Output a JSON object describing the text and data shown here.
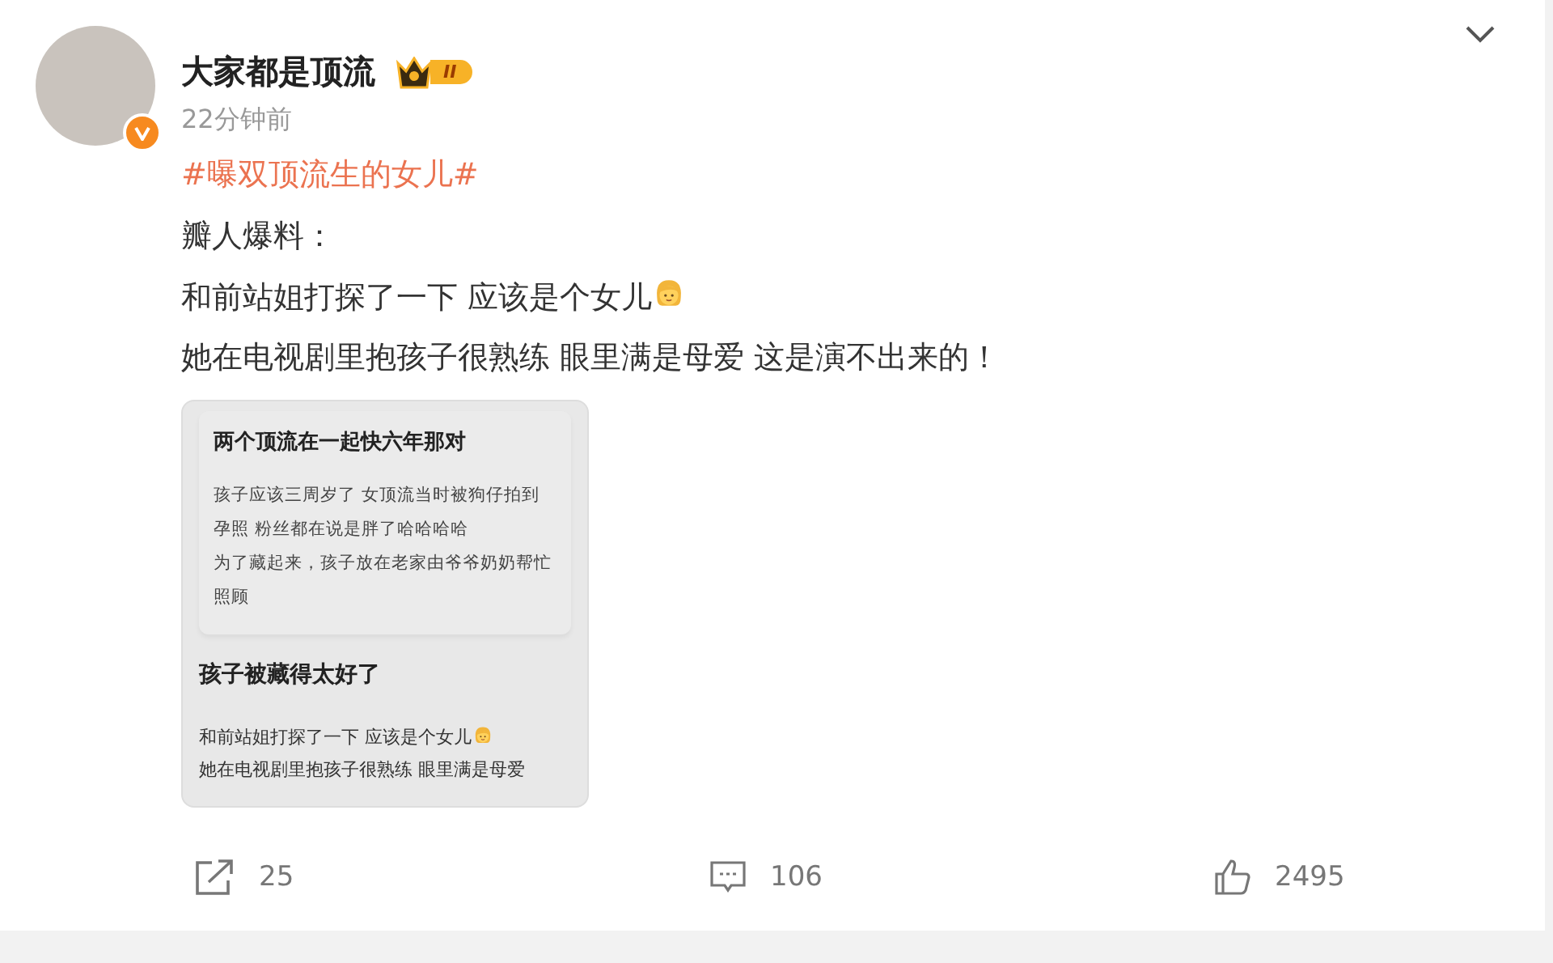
{
  "post": {
    "author": {
      "name": "大家都是顶流",
      "level_badge": "II",
      "verified": true
    },
    "time": "22分钟前",
    "hashtag": "#曝双顶流生的女儿#",
    "lines": [
      {
        "text": "瓣人爆料：",
        "emoji": false
      },
      {
        "text": "和前站姐打探了一下 应该是个女儿",
        "emoji": true
      },
      {
        "text": "她在电视剧里抱孩子很熟练 眼里满是母爱 这是演不出来的！",
        "emoji": false
      }
    ],
    "attached_image": {
      "card_title": "两个顶流在一起快六年那对",
      "card_lines": [
        "孩子应该三周岁了  女顶流当时被狗仔拍到",
        "孕照   粉丝都在说是胖了哈哈哈哈",
        "为了藏起来，孩子放在老家由爷爷奶奶帮忙",
        "照顾"
      ],
      "heading": "孩子被藏得太好了",
      "lines": [
        {
          "text": "和前站姐打探了一下  应该是个女儿",
          "emoji": true
        },
        {
          "text": "她在电视剧里抱孩子很熟练  眼里满是母爱",
          "emoji": false
        }
      ]
    },
    "actions": [
      {
        "kind": "share",
        "count": "25"
      },
      {
        "kind": "comment",
        "count": "106"
      },
      {
        "kind": "like",
        "count": "2495"
      }
    ]
  }
}
